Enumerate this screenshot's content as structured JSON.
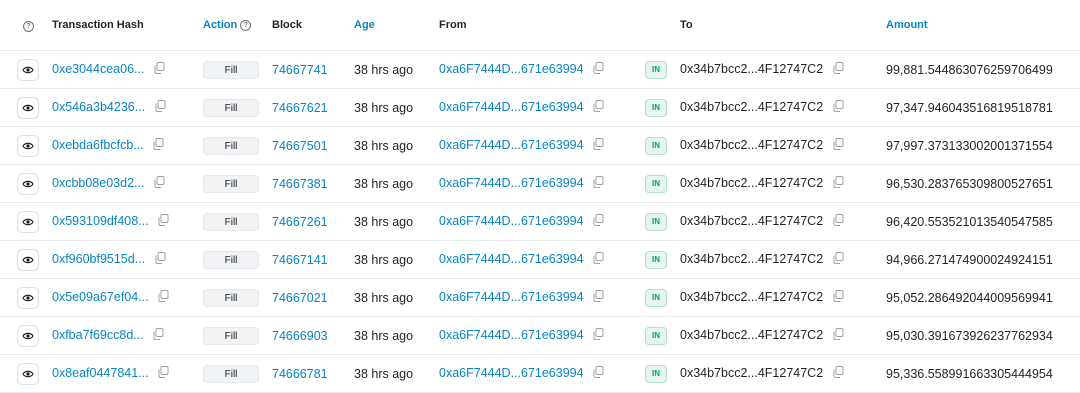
{
  "header": {
    "help_icon": "?",
    "tx_hash": "Transaction Hash",
    "action": "Action",
    "action_help_icon": "?",
    "block": "Block",
    "age": "Age",
    "from": "From",
    "to": "To",
    "amount": "Amount"
  },
  "colors": {
    "link": "#0784c3",
    "in_badge": "#00a186",
    "border": "#e9ecef"
  },
  "rows": [
    {
      "hash": "0xe3044cea06...",
      "action": "Fill",
      "block": "74667741",
      "age": "38 hrs ago",
      "from": "0xa6F7444D...671e63994",
      "direction": "IN",
      "to": "0x34b7bcc2...4F12747C2",
      "amount": "99,881.544863076259706499"
    },
    {
      "hash": "0x546a3b4236...",
      "action": "Fill",
      "block": "74667621",
      "age": "38 hrs ago",
      "from": "0xa6F7444D...671e63994",
      "direction": "IN",
      "to": "0x34b7bcc2...4F12747C2",
      "amount": "97,347.946043516819518781"
    },
    {
      "hash": "0xebda6fbcfcb...",
      "action": "Fill",
      "block": "74667501",
      "age": "38 hrs ago",
      "from": "0xa6F7444D...671e63994",
      "direction": "IN",
      "to": "0x34b7bcc2...4F12747C2",
      "amount": "97,997.373133002001371554"
    },
    {
      "hash": "0xcbb08e03d2...",
      "action": "Fill",
      "block": "74667381",
      "age": "38 hrs ago",
      "from": "0xa6F7444D...671e63994",
      "direction": "IN",
      "to": "0x34b7bcc2...4F12747C2",
      "amount": "96,530.283765309800527651"
    },
    {
      "hash": "0x593109df408...",
      "action": "Fill",
      "block": "74667261",
      "age": "38 hrs ago",
      "from": "0xa6F7444D...671e63994",
      "direction": "IN",
      "to": "0x34b7bcc2...4F12747C2",
      "amount": "96,420.553521013540547585"
    },
    {
      "hash": "0xf960bf9515d...",
      "action": "Fill",
      "block": "74667141",
      "age": "38 hrs ago",
      "from": "0xa6F7444D...671e63994",
      "direction": "IN",
      "to": "0x34b7bcc2...4F12747C2",
      "amount": "94,966.271474900024924151"
    },
    {
      "hash": "0x5e09a67ef04...",
      "action": "Fill",
      "block": "74667021",
      "age": "38 hrs ago",
      "from": "0xa6F7444D...671e63994",
      "direction": "IN",
      "to": "0x34b7bcc2...4F12747C2",
      "amount": "95,052.286492044009569941"
    },
    {
      "hash": "0xfba7f69cc8d...",
      "action": "Fill",
      "block": "74666903",
      "age": "38 hrs ago",
      "from": "0xa6F7444D...671e63994",
      "direction": "IN",
      "to": "0x34b7bcc2...4F12747C2",
      "amount": "95,030.391673926237762934"
    },
    {
      "hash": "0x8eaf0447841...",
      "action": "Fill",
      "block": "74666781",
      "age": "38 hrs ago",
      "from": "0xa6F7444D...671e63994",
      "direction": "IN",
      "to": "0x34b7bcc2...4F12747C2",
      "amount": "95,336.558991663305444954"
    }
  ]
}
